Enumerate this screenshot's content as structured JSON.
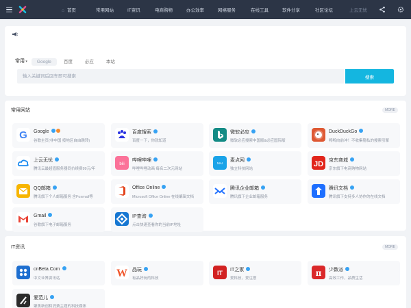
{
  "header": {
    "nav": [
      "首页",
      "常用网站",
      "IT资讯",
      "电商购物",
      "办公效率",
      "网络服务",
      "在线工具",
      "软件分享",
      "社区论坛",
      "上云无忧"
    ]
  },
  "search": {
    "category": "常用",
    "engines": [
      "Google",
      "百度",
      "必应",
      "本站"
    ],
    "active_engine": 0,
    "placeholder": "输入关键词后回车即可搜索",
    "button": "搜索"
  },
  "sections": [
    {
      "title": "常用网站",
      "more": "MORE",
      "items": [
        {
          "name": "Google",
          "desc": "谷歌主页(非中国 按地区自由跳转)",
          "icon": "google-icon",
          "color": "#ffffff",
          "hot": true
        },
        {
          "name": "百度搜索",
          "desc": "百度一下，你就知道",
          "icon": "baidu-icon",
          "color": "#ffffff",
          "hot": false
        },
        {
          "name": "微软必应",
          "desc": "微软必应搜索中国版&必应国际版",
          "icon": "bing-icon",
          "color": "#138b85",
          "hot": false
        },
        {
          "name": "DuckDuckGo",
          "desc": "鸭鸭向前冲！不收集隐私的搜索引擎",
          "icon": "duckduckgo-icon",
          "color": "#de5833",
          "hot": false
        },
        {
          "name": "上云无忧",
          "desc": "腾讯云最超值服务器同价续费99元/年",
          "icon": "cloud-icon",
          "color": "#ffffff",
          "hot": false
        },
        {
          "name": "哔哩哔哩",
          "desc": "哔哩哔哩动画 每名二次元网站",
          "icon": "bilibili-icon",
          "color": "#fb7299",
          "hot": false
        },
        {
          "name": "麦点网",
          "desc": "独立科技网站",
          "icon": "maidian-icon",
          "color": "#1aa3e8",
          "hot": false
        },
        {
          "name": "京东商城",
          "desc": "京东旗下电商购物网站",
          "icon": "jd-icon",
          "color": "#e1251b",
          "hot": false
        },
        {
          "name": "QQ邮箱",
          "desc": "腾讯旗下个人邮箱服务 含Foxmail等",
          "icon": "qqmail-icon",
          "color": "#f7b500",
          "hot": false
        },
        {
          "name": "Office Online",
          "desc": "Microsoft Office Online 在线编辑文档",
          "icon": "office-icon",
          "color": "#ffffff",
          "hot": false
        },
        {
          "name": "腾讯企业邮箱",
          "desc": "腾讯旗下企业邮箱服务",
          "icon": "exmail-icon",
          "color": "#ffffff",
          "hot": false
        },
        {
          "name": "腾讯文档",
          "desc": "腾讯旗下支持多人协作的在线文档",
          "icon": "tencent-docs-icon",
          "color": "#1e6fff",
          "hot": false
        },
        {
          "name": "Gmail",
          "desc": "谷歌旗下电子邮箱服务",
          "icon": "gmail-icon",
          "color": "#ffffff",
          "hot": false
        },
        {
          "name": "IP查询",
          "desc": "点击快速查看你的当前IP地址",
          "icon": "ip-lookup-icon",
          "color": "#1677d2",
          "hot": false
        }
      ]
    },
    {
      "title": "IT资讯",
      "more": "MORE",
      "items": [
        {
          "name": "cnBeta.Com",
          "desc": "中文业界资讯站",
          "icon": "cnbeta-icon",
          "color": "#1e6fd0",
          "hot": false
        },
        {
          "name": "品玩",
          "desc": "有品好玩的科技",
          "icon": "pingwest-icon",
          "color": "#ffffff",
          "hot": false
        },
        {
          "name": "IT之家",
          "desc": "爱科技，爱注意",
          "icon": "ithome-icon",
          "color": "#d22222",
          "hot": false
        },
        {
          "name": "少数派",
          "desc": "高效工作，品质生活",
          "icon": "sspai-icon",
          "color": "#da282a",
          "hot": false
        },
        {
          "name": "爱范儿",
          "desc": "聚焦新创和消费主题的科技媒体",
          "icon": "ifanr-icon",
          "color": "#2b2b2b",
          "hot": false
        }
      ]
    }
  ]
}
